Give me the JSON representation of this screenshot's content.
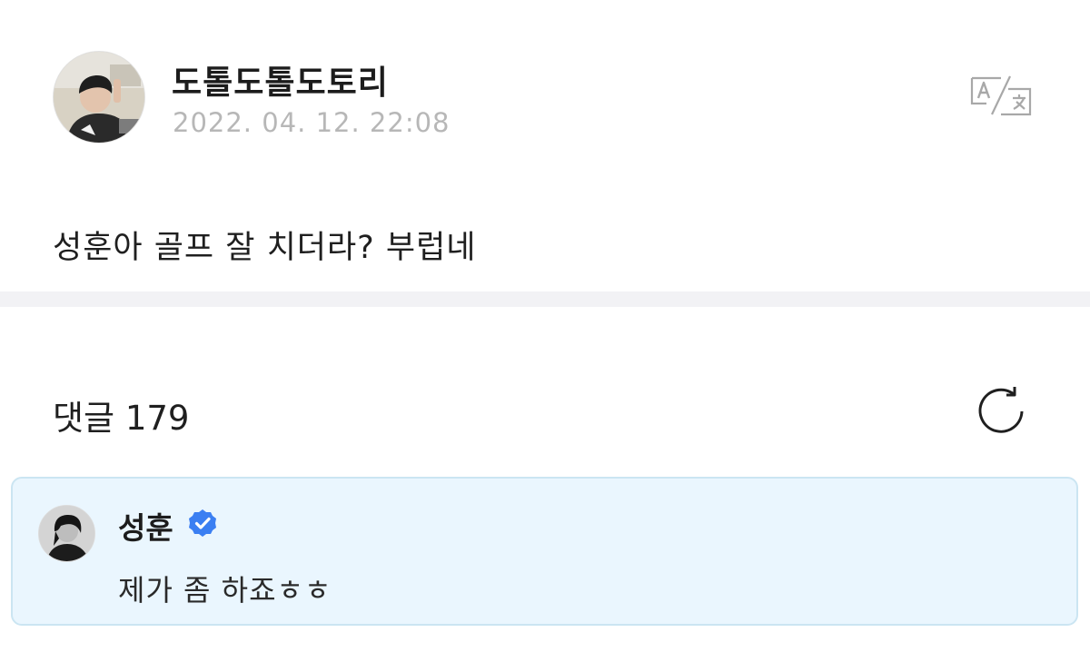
{
  "post": {
    "author": "도톨도톨도토리",
    "date": "2022. 04. 12. 22:08",
    "body": "성훈아 골프 잘 치더라? 부럽네",
    "avatar_icon": "user-photo-avatar",
    "translate_icon": "translate-icon"
  },
  "comments": {
    "title": "댓글 179",
    "refresh_icon": "refresh-icon",
    "items": [
      {
        "author": "성훈",
        "verified": true,
        "text": "제가 좀 하죠ㅎㅎ"
      }
    ]
  },
  "colors": {
    "accent_verified": "#3b7ff2",
    "comment_highlight_bg": "#eaf6fe",
    "comment_highlight_border": "#cbe5f2",
    "date_gray": "#b7b7b7",
    "divider": "#f2f2f5"
  }
}
